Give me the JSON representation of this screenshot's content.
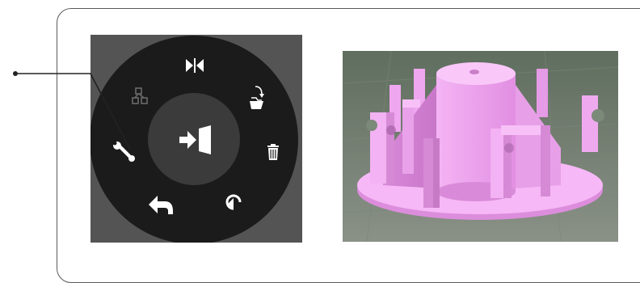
{
  "radial_menu": {
    "center_action": {
      "icon": "enter-door-icon"
    },
    "items": [
      {
        "icon": "mirror-icon",
        "state": "enabled"
      },
      {
        "icon": "open-folder-icon",
        "state": "enabled"
      },
      {
        "icon": "trash-icon",
        "state": "enabled"
      },
      {
        "icon": "rotate-icon",
        "state": "enabled"
      },
      {
        "icon": "undo-arrow-icon",
        "state": "enabled"
      },
      {
        "icon": "wrench-icon",
        "state": "enabled"
      },
      {
        "icon": "arrange-icon",
        "state": "disabled"
      }
    ],
    "colors": {
      "panel": "#545454",
      "ring": "#1b1b1b",
      "hub": "#3b3b3b",
      "icon": "#ffffff",
      "icon_disabled": "#6a6a6a"
    }
  },
  "model_preview": {
    "object_color": "#f2a9f2",
    "background_color": "#6e7d6c"
  },
  "callout": {
    "line_color": "#222222"
  }
}
